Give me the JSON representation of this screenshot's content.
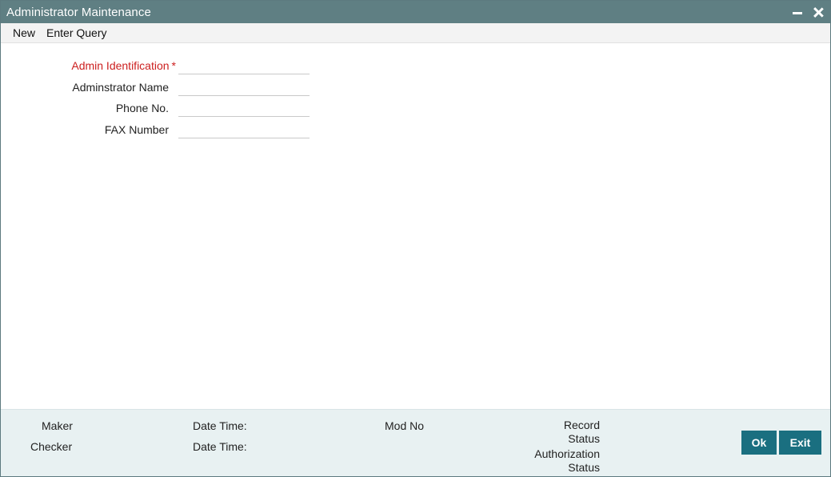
{
  "window": {
    "title": "Administrator Maintenance",
    "minimize_icon": "minimize-icon",
    "close_icon": "close-icon"
  },
  "menu": {
    "items": [
      {
        "label": "New"
      },
      {
        "label": "Enter Query"
      }
    ]
  },
  "form": {
    "fields": [
      {
        "label": "Admin Identification",
        "required": true,
        "required_mark": "*",
        "value": ""
      },
      {
        "label": "Adminstrator Name",
        "required": false,
        "value": ""
      },
      {
        "label": "Phone No.",
        "required": false,
        "value": ""
      },
      {
        "label": "FAX Number",
        "required": false,
        "value": ""
      }
    ]
  },
  "footer": {
    "maker_label": "Maker",
    "checker_label": "Checker",
    "maker_datetime_label": "Date Time:",
    "checker_datetime_label": "Date Time:",
    "mod_no_label": "Mod No",
    "record_status_label_1": "Record",
    "record_status_label_2": "Status",
    "authorization_status_label_1": "Authorization",
    "authorization_status_label_2": "Status",
    "ok_label": "Ok",
    "exit_label": "Exit"
  },
  "colors": {
    "titlebar": "#5f7f83",
    "required_label": "#cc1f1f",
    "footer_bg": "#e8f1f2",
    "button_bg": "#1a6f80"
  }
}
